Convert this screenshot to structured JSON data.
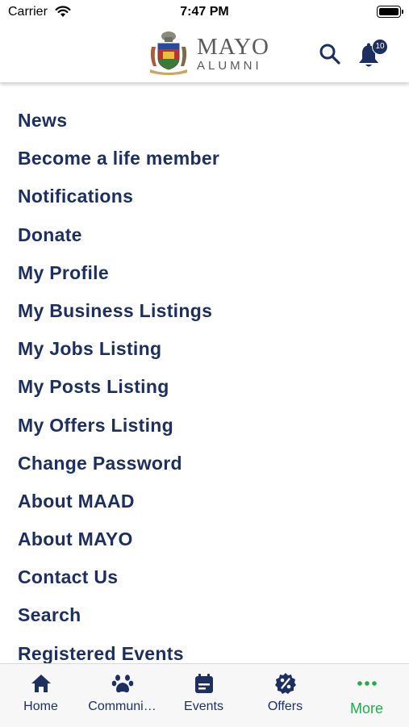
{
  "status_bar": {
    "carrier": "Carrier",
    "time": "7:47 PM"
  },
  "header": {
    "logo": {
      "line1": "MAYO",
      "line2": "ALUMNI"
    },
    "notification_count": "10"
  },
  "menu": {
    "items": [
      {
        "label": "News"
      },
      {
        "label": "Become a life member"
      },
      {
        "label": "Notifications"
      },
      {
        "label": "Donate"
      },
      {
        "label": "My Profile"
      },
      {
        "label": "My Business Listings"
      },
      {
        "label": "My Jobs Listing"
      },
      {
        "label": "My Posts Listing"
      },
      {
        "label": "My Offers Listing"
      },
      {
        "label": "Change Password"
      },
      {
        "label": "About MAAD"
      },
      {
        "label": "About MAYO"
      },
      {
        "label": "Contact Us"
      },
      {
        "label": "Search"
      },
      {
        "label": "Registered Events"
      }
    ]
  },
  "tabbar": {
    "tabs": [
      {
        "label": "Home",
        "icon": "home-icon"
      },
      {
        "label": "Communi…",
        "icon": "paw-icon"
      },
      {
        "label": "Events",
        "icon": "calendar-icon"
      },
      {
        "label": "Offers",
        "icon": "percent-badge-icon"
      },
      {
        "label": "More",
        "icon": "more-dots-icon",
        "active": true
      }
    ]
  },
  "colors": {
    "primary": "#1d2f5f",
    "active": "#2aa84a",
    "logo_text": "#5a5a5a"
  }
}
